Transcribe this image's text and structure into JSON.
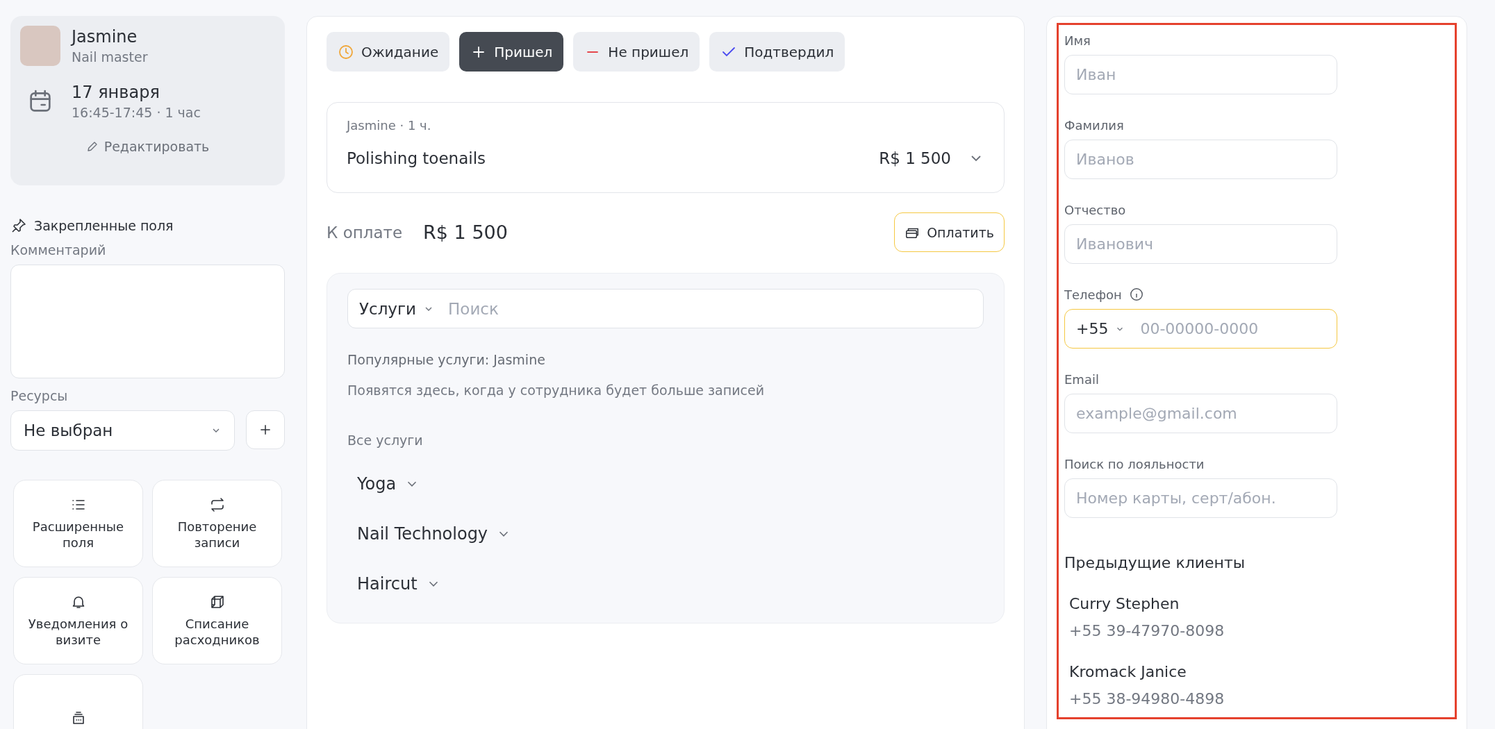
{
  "appointment_card": {
    "master_name": "Jasmine",
    "master_role": "Nail master",
    "date": "17 января",
    "time": "16:45-17:45 · 1 час",
    "edit_button": "Редактировать"
  },
  "pinned_fields": {
    "title": "Закрепленные поля",
    "comment_label": "Комментарий",
    "resources_label": "Ресурсы",
    "resources_value": "Не выбран"
  },
  "actions": [
    {
      "kind": "list",
      "label": "Расширенные поля"
    },
    {
      "kind": "repeat",
      "label": "Повторение записи"
    },
    {
      "kind": "bell",
      "label": "Уведомления о визите"
    },
    {
      "kind": "cube",
      "label": "Списание расходников"
    },
    {
      "kind": "register"
    }
  ],
  "status_buttons": [
    {
      "kind": "clock",
      "label": "Ожидание",
      "selected": false
    },
    {
      "kind": "plus",
      "label": "Пришел",
      "selected": true
    },
    {
      "kind": "minus",
      "label": "Не пришел",
      "selected": false
    },
    {
      "kind": "check",
      "label": "Подтвердил",
      "selected": false
    }
  ],
  "service": {
    "meta": "Jasmine · 1 ч.",
    "name": "Polishing toenails",
    "price": "R$ 1 500"
  },
  "payment": {
    "label": "К оплате",
    "amount": "R$ 1 500",
    "button": "Оплатить"
  },
  "catalog": {
    "category": "Услуги",
    "search_placeholder": "Поиск",
    "popular_title": "Популярные услуги: Jasmine",
    "popular_hint": "Появятся здесь, когда у сотрудника будет больше записей",
    "all_title": "Все услуги",
    "groups": [
      {
        "name": "Yoga",
        "expanded": false
      },
      {
        "name": "Nail Technology",
        "expanded": false
      },
      {
        "name": "Haircut",
        "expanded": false
      }
    ]
  },
  "client_form": {
    "highlighted": true,
    "fields": [
      {
        "kind": "text",
        "label": "Имя",
        "placeholder": "Иван",
        "focused": false
      },
      {
        "kind": "text",
        "label": "Фамилия",
        "placeholder": "Иванов",
        "focused": false
      },
      {
        "kind": "text",
        "label": "Отчество",
        "placeholder": "Иванович",
        "focused": false
      },
      {
        "kind": "phone",
        "label": "Телефон",
        "country_code": "+55",
        "placeholder": "00-00000-0000",
        "focused": true
      },
      {
        "kind": "text",
        "label": "Email",
        "placeholder": "example@gmail.com",
        "focused": false
      },
      {
        "kind": "text",
        "label": "Поиск по лояльности",
        "placeholder": "Номер карты, серт/абон.",
        "focused": false
      }
    ],
    "previous_title": "Предыдущие клиенты",
    "previous_clients": [
      {
        "name": "Curry Stephen",
        "phone": "+55 39-47970-8098"
      },
      {
        "name": "Kromack Janice",
        "phone": "+55 38-94980-4898"
      }
    ]
  }
}
